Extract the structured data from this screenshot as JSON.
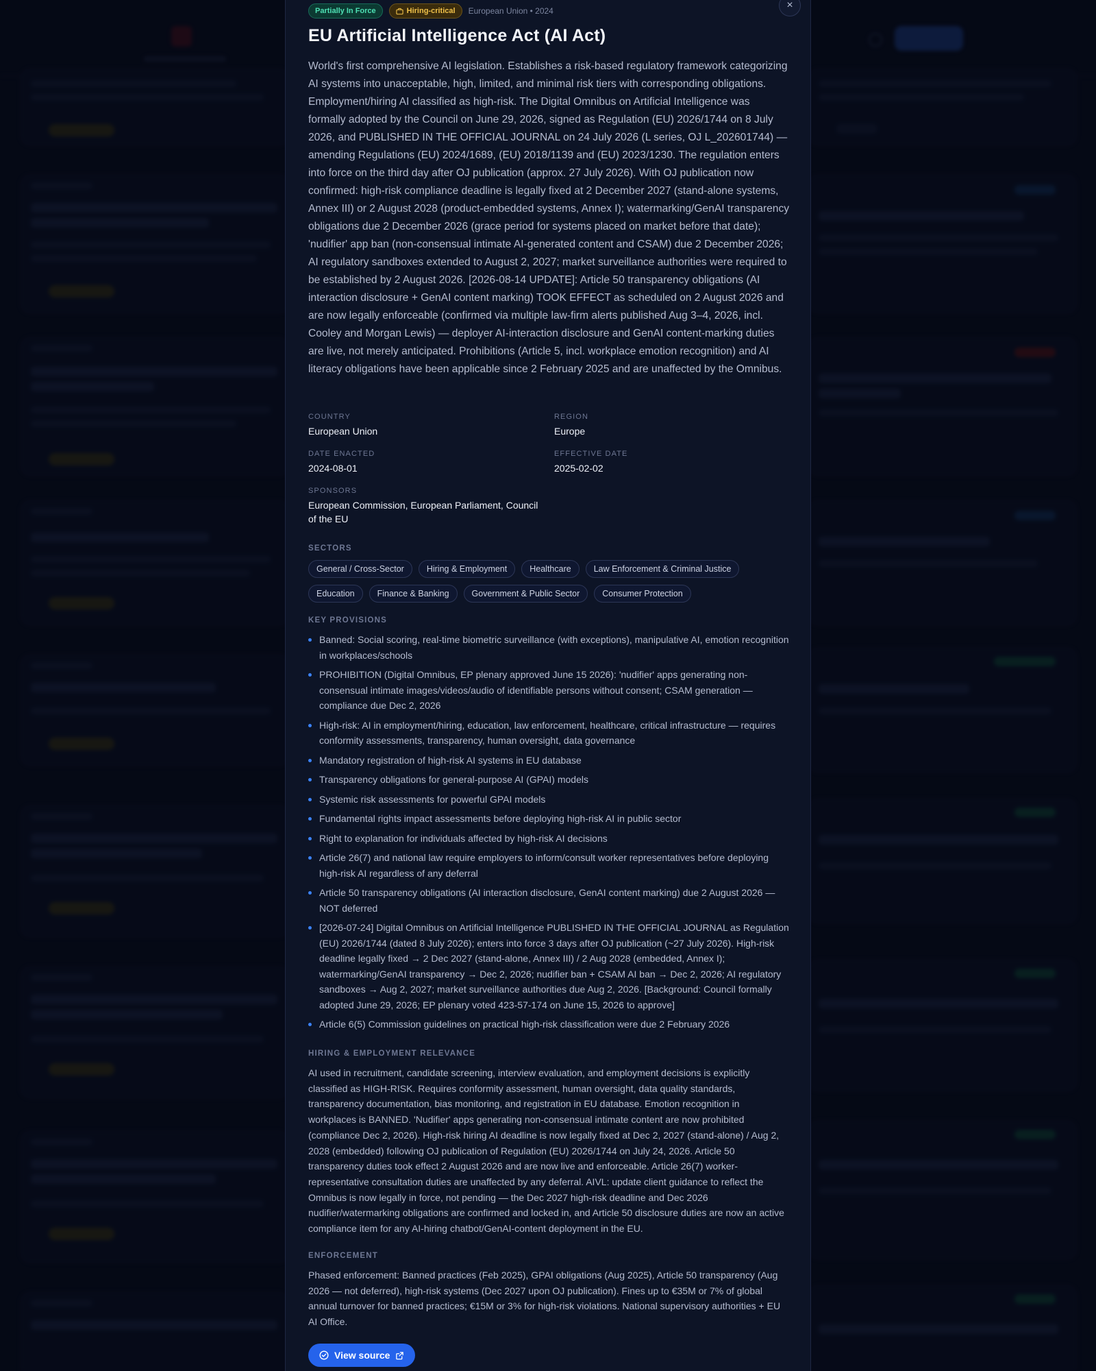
{
  "modal": {
    "status_badge": "Partially In Force",
    "hiring_badge": "Hiring-critical",
    "meta": "European Union • 2024",
    "close_symbol": "×",
    "title": "EU Artificial Intelligence Act (AI Act)",
    "description": "World's first comprehensive AI legislation. Establishes a risk-based regulatory framework categorizing AI systems into unacceptable, high, limited, and minimal risk tiers with corresponding obligations. Employment/hiring AI classified as high-risk. The Digital Omnibus on Artificial Intelligence was formally adopted by the Council on June 29, 2026, signed as Regulation (EU) 2026/1744 on 8 July 2026, and PUBLISHED IN THE OFFICIAL JOURNAL on 24 July 2026 (L series, OJ L_202601744) — amending Regulations (EU) 2024/1689, (EU) 2018/1139 and (EU) 2023/1230. The regulation enters into force on the third day after OJ publication (approx. 27 July 2026). With OJ publication now confirmed: high-risk compliance deadline is legally fixed at 2 December 2027 (stand-alone systems, Annex III) or 2 August 2028 (product-embedded systems, Annex I); watermarking/GenAI transparency obligations due 2 December 2026 (grace period for systems placed on market before that date); 'nudifier' app ban (non-consensual intimate AI-generated content and CSAM) due 2 December 2026; AI regulatory sandboxes extended to August 2, 2027; market surveillance authorities were required to be established by 2 August 2026. [2026-08-14 UPDATE]: Article 50 transparency obligations (AI interaction disclosure + GenAI content marking) TOOK EFFECT as scheduled on 2 August 2026 and are now legally enforceable (confirmed via multiple law-firm alerts published Aug 3–4, 2026, incl. Cooley and Morgan Lewis) — deployer AI-interaction disclosure and GenAI content-marking duties are live, not merely anticipated. Prohibitions (Article 5, incl. workplace emotion recognition) and AI literacy obligations have been applicable since 2 February 2025 and are unaffected by the Omnibus.",
    "fields": {
      "country_label": "Country",
      "country": "European Union",
      "region_label": "Region",
      "region": "Europe",
      "date_enacted_label": "Date Enacted",
      "date_enacted": "2024-08-01",
      "effective_date_label": "Effective Date",
      "effective_date": "2025-02-02",
      "sponsors_label": "Sponsors",
      "sponsors": "European Commission, European Parliament, Council of the EU"
    },
    "sectors_label": "Sectors",
    "sectors": [
      "General / Cross-Sector",
      "Hiring & Employment",
      "Healthcare",
      "Law Enforcement & Criminal Justice",
      "Education",
      "Finance & Banking",
      "Government & Public Sector",
      "Consumer Protection"
    ],
    "provisions_label": "Key Provisions",
    "provisions": [
      "Banned: Social scoring, real-time biometric surveillance (with exceptions), manipulative AI, emotion recognition in workplaces/schools",
      "PROHIBITION (Digital Omnibus, EP plenary approved June 15 2026): 'nudifier' apps generating non-consensual intimate images/videos/audio of identifiable persons without consent; CSAM generation — compliance due Dec 2, 2026",
      "High-risk: AI in employment/hiring, education, law enforcement, healthcare, critical infrastructure — requires conformity assessments, transparency, human oversight, data governance",
      "Mandatory registration of high-risk AI systems in EU database",
      "Transparency obligations for general-purpose AI (GPAI) models",
      "Systemic risk assessments for powerful GPAI models",
      "Fundamental rights impact assessments before deploying high-risk AI in public sector",
      "Right to explanation for individuals affected by high-risk AI decisions",
      "Article 26(7) and national law require employers to inform/consult worker representatives before deploying high-risk AI regardless of any deferral",
      "Article 50 transparency obligations (AI interaction disclosure, GenAI content marking) due 2 August 2026 — NOT deferred",
      "[2026-07-24] Digital Omnibus on Artificial Intelligence PUBLISHED IN THE OFFICIAL JOURNAL as Regulation (EU) 2026/1744 (dated 8 July 2026); enters into force 3 days after OJ publication (~27 July 2026). High-risk deadline legally fixed → 2 Dec 2027 (stand-alone, Annex III) / 2 Aug 2028 (embedded, Annex I); watermarking/GenAI transparency → Dec 2, 2026; nudifier ban + CSAM AI ban → Dec 2, 2026; AI regulatory sandboxes → Aug 2, 2027; market surveillance authorities due Aug 2, 2026. [Background: Council formally adopted June 29, 2026; EP plenary voted 423-57-174 on June 15, 2026 to approve]",
      "Article 6(5) Commission guidelines on practical high-risk classification were due 2 February 2026"
    ],
    "hiring_label": "Hiring & Employment Relevance",
    "hiring_text": "AI used in recruitment, candidate screening, interview evaluation, and employment decisions is explicitly classified as HIGH-RISK. Requires conformity assessment, human oversight, data quality standards, transparency documentation, bias monitoring, and registration in EU database. Emotion recognition in workplaces is BANNED. 'Nudifier' apps generating non-consensual intimate content are now prohibited (compliance Dec 2, 2026). High-risk hiring AI deadline is now legally fixed at Dec 2, 2027 (stand-alone) / Aug 2, 2028 (embedded) following OJ publication of Regulation (EU) 2026/1744 on July 24, 2026. Article 50 transparency duties took effect 2 August 2026 and are now live and enforceable. Article 26(7) worker-representative consultation duties are unaffected by any deferral. AIVL: update client guidance to reflect the Omnibus is now legally in force, not pending — the Dec 2027 high-risk deadline and Dec 2026 nudifier/watermarking obligations are confirmed and locked in, and Article 50 disclosure duties are now an active compliance item for any AI-hiring chatbot/GenAI-content deployment in the EU.",
    "enforcement_label": "Enforcement",
    "enforcement_text": "Phased enforcement: Banned practices (Feb 2025), GPAI obligations (Aug 2025), Article 50 transparency (Aug 2026 — not deferred), high-risk systems (Dec 2027 upon OJ publication). Fines up to €35M or 7% of global annual turnover for banned practices; €15M or 3% for high-risk violations. National supervisory authorities + EU AI Office.",
    "view_source_label": "View source"
  },
  "colors": {
    "accent": "#3b82f6",
    "status_green": "#4ee0b4",
    "hiring_amber": "#f0c14a",
    "button_blue": "#2563eb"
  }
}
